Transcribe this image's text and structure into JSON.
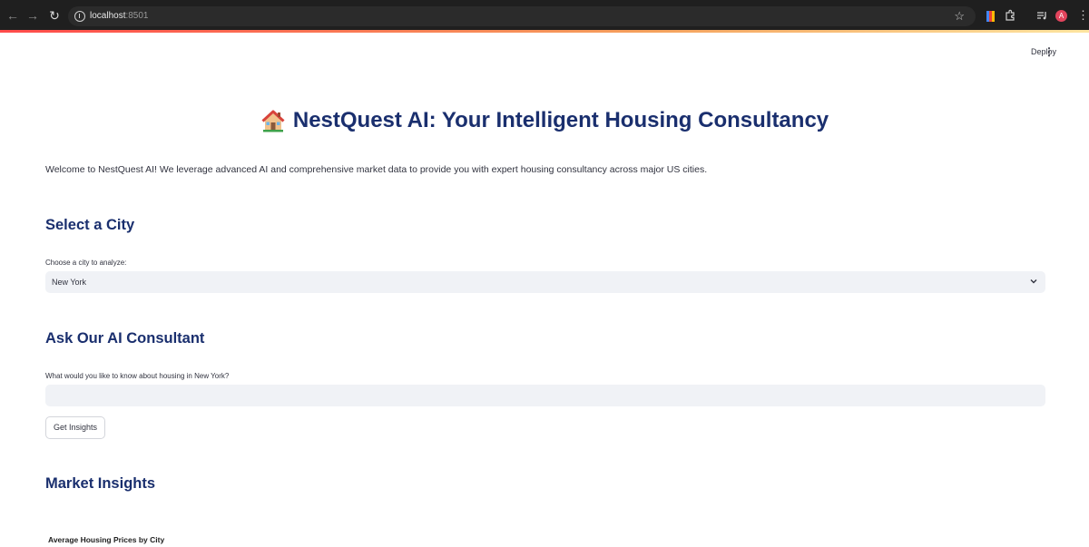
{
  "browser": {
    "url_host": "localhost",
    "url_port": ":8501",
    "avatar_letter": "A",
    "icons": [
      "back-icon",
      "forward-icon",
      "reload-icon",
      "site-info-icon",
      "bookmark-star-icon",
      "extension-icon",
      "puzzle-icon",
      "media-queue-icon",
      "chrome-menu-icon"
    ]
  },
  "app_header": {
    "deploy_label": "Deploy",
    "menu_glyph": "⋮"
  },
  "main": {
    "title": "NestQuest AI: Your Intelligent Housing Consultancy",
    "welcome": "Welcome to NestQuest AI! We leverage advanced AI and comprehensive market data to provide you with expert housing consultancy across major US cities.",
    "select_city": {
      "heading": "Select a City",
      "label": "Choose a city to analyze:",
      "selected": "New York"
    },
    "consultant": {
      "heading": "Ask Our AI Consultant",
      "label": "What would you like to know about housing in New York?",
      "input_value": "",
      "button_label": "Get Insights"
    },
    "insights": {
      "heading": "Market Insights",
      "chart_title": "Average Housing Prices by City"
    }
  },
  "colors": {
    "heading": "#1a2f6e",
    "text": "#31333f",
    "input_bg": "#f0f2f6",
    "accent": "#ff4b4b"
  }
}
